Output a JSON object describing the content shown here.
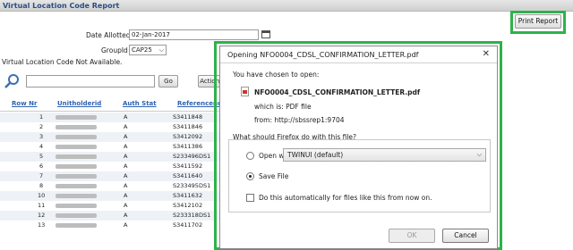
{
  "page": {
    "title": "Virtual Location Code Report"
  },
  "toolbar": {
    "print_label": "Print Report"
  },
  "form": {
    "date_label": "Date Allotted",
    "date_value": "02-Jan-2017",
    "group_label": "GroupId",
    "group_value": "CAP25",
    "notice": "Virtual Location Code Not Available."
  },
  "search": {
    "value": "",
    "go_label": "Go",
    "actions_label": "Actions"
  },
  "table": {
    "headers": [
      "Row Nr",
      "Unitholderid",
      "Auth Stat",
      "Referencenu"
    ],
    "rows": [
      {
        "nr": "1",
        "auth": "A",
        "ref": "S3411848"
      },
      {
        "nr": "2",
        "auth": "A",
        "ref": "S3411846"
      },
      {
        "nr": "3",
        "auth": "A",
        "ref": "S3412092"
      },
      {
        "nr": "4",
        "auth": "A",
        "ref": "S3411386"
      },
      {
        "nr": "5",
        "auth": "A",
        "ref": "S233496DS1"
      },
      {
        "nr": "6",
        "auth": "A",
        "ref": "S3411592"
      },
      {
        "nr": "7",
        "auth": "A",
        "ref": "S3411640"
      },
      {
        "nr": "8",
        "auth": "A",
        "ref": "S233495DS1"
      },
      {
        "nr": "10",
        "auth": "A",
        "ref": "S3411632"
      },
      {
        "nr": "11",
        "auth": "A",
        "ref": "S3412102"
      },
      {
        "nr": "12",
        "auth": "A",
        "ref": "S233318DS1"
      },
      {
        "nr": "13",
        "auth": "A",
        "ref": "S3411702"
      }
    ]
  },
  "dialog": {
    "title": "Opening NFO0004_CDSL_CONFIRMATION_LETTER.pdf",
    "close": "✕",
    "intro": "You have chosen to open:",
    "filename": "NFO0004_CDSL_CONFIRMATION_LETTER.pdf",
    "which_is": "which is:  PDF file",
    "from": "from:  http://sbssrep1:9704",
    "question": "What should Firefox do with this file?",
    "open_with_label": "Open with",
    "open_with_value": "TWINUI (default)",
    "save_label": "Save File",
    "auto_label": "Do this automatically for files like this from now on.",
    "ok_label": "OK",
    "cancel_label": "Cancel",
    "selected_option": "save-file",
    "auto_checked": false
  },
  "colors": {
    "highlight": "#2db34a",
    "link": "#2f62b0"
  }
}
